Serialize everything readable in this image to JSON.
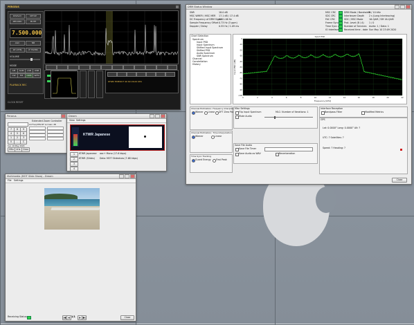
{
  "desktop": {
    "colors": {
      "background": "#8a939d",
      "apple_logo": "#d7d9dc"
    }
  },
  "perseus": {
    "title": "PERSEUS",
    "frequency": "7.500.000",
    "status_line": "KTWR  TIMEOUT  40  60  26.00 KHz",
    "playback_label": "PLAYBACK REC",
    "bottom_line": "CLOCK RESET",
    "labels": [
      "DISPLAY",
      "SETUP",
      "RECORD",
      "MUTE",
      "AGC",
      "NB",
      "RF ATTN",
      "IF FILTER",
      "VOLUME",
      "MODE"
    ],
    "mode_buttons": [
      "AM",
      "SAM",
      "LSB",
      "USB",
      "CW",
      "FM",
      "DRM",
      "WFM"
    ],
    "colors": {
      "panel": "#1c1c1c",
      "freq": "#f1c34a",
      "spectrum": "#d0d0d0",
      "accent": "#3ad65a"
    }
  },
  "drm": {
    "title": "DRM Status Window",
    "stats_left": [
      {
        "k": "SNR",
        "v": "18.0 dB"
      },
      {
        "k": "MSC WMER / MSC MER",
        "v": "17.1 dB / 17.4 dB"
      },
      {
        "k": "DC Frequency of DRM Signal",
        "v": "6011.06 Hz"
      },
      {
        "k": "Sample Frequency Offset",
        "v": "0.73 Hz (3 ppm)"
      },
      {
        "k": "Doppler / Delay",
        "v": "0.55 Hz / 1.09 ms"
      }
    ],
    "stats_right": [
      {
        "k": "DRM Mode / Bandwidth",
        "v": "B / 10 kHz"
      },
      {
        "k": "Interleaver Depth",
        "v": "2 s (Long Interleaving)"
      },
      {
        "k": "SDC / MSC Mode",
        "v": "16-QAM / SM 16-QAM"
      },
      {
        "k": "Prot. Level (B / A)",
        "v": "1 / 0"
      },
      {
        "k": "Number of Services",
        "v": "Audio: 1 / Data: 1"
      },
      {
        "k": "Received time - date",
        "v": "Sun May 10 23:09 2020"
      }
    ],
    "status_labels": [
      "MSC CRC",
      "SDC CRC",
      "FAC CRC",
      "Frame Sync",
      "Time Sync Acq",
      "IO Interface"
    ],
    "tree": [
      "Chart Selection",
      "Spectrum",
      "Input PSD",
      "Input Spectrum",
      "Shifted Input Spectrum",
      "Shifted PSD",
      "Audio Spectrum",
      "SNR Spectrum",
      "Channel",
      "Constellation",
      "History"
    ],
    "chart": {
      "title": "Input PSD",
      "xlabel": "Frequency [kHz]",
      "ylabel": "Input PSD [dB]",
      "xticks": [
        "0",
        "2",
        "4",
        "6",
        "8",
        "10",
        "12",
        "14",
        "16",
        "18",
        "20",
        "22"
      ],
      "yticks": [
        "0",
        "-10",
        "-20",
        "-30",
        "-40",
        "-50",
        "-60",
        "-70",
        "-80",
        "-90",
        "-100"
      ],
      "line_color": "#2fe82f",
      "background": "#000000"
    },
    "bottom": {
      "chan_est_freq_title": "Channel Estimation: Frequency Interpolation",
      "freq_opts": [
        "Wiener",
        "Linear",
        "DFT Zero Pad"
      ],
      "chan_est_time_title": "Channel Estimation: Time Interpolation",
      "time_opts": [
        "Wiener",
        "Linear"
      ],
      "time_sync_title": "Time Sync Tracking",
      "sync_opts": [
        "Guard Energy",
        "First Peak"
      ],
      "misc_title": "Misc Settings",
      "misc_opts": [
        "Flip Input Spectrum",
        "Mute Audio"
      ],
      "mlc_label": "MLC: Number of Iterations: 1",
      "file_title": "Save File Audio",
      "file_opts": [
        "Save File Timer",
        "Save Audio as WAV",
        "Reverberation"
      ],
      "iface_title": "Interface Reception",
      "iface_opts": [
        "Bandpass Filter",
        "Modified Metrics"
      ],
      "gps_title": "GPS",
      "gps_lines": [
        "Lat: 0.0000°  Long: 0.0000°  Alt: ?",
        "UTC: ?  Satellites: ?",
        "Speed: ?  Heading: ?"
      ],
      "close": "Close"
    }
  },
  "clock": {
    "title": "Perseus",
    "subtitle": "Extended Zoom Controller",
    "grid_header": "LO Freq  MHz  RF Lvl  Gain dB",
    "keypad": [
      "7",
      "8",
      "9",
      "4",
      "5",
      "6",
      "1",
      "2",
      "3",
      "0",
      ".",
      "C"
    ],
    "date": "Sun 10 May 2020",
    "buttons": [
      "MHz",
      "kHz",
      "Clear"
    ]
  },
  "dream": {
    "title": "Dream",
    "menu": [
      "View",
      "Settings"
    ],
    "station": "KTWR  Japanese",
    "services": [
      {
        "num": "1",
        "name": "KTWR  Japanese",
        "info": "aac+ Mono (17.6 kbps)"
      },
      {
        "num": "2",
        "name": "KTWR  (Slides)",
        "info": "Data: MOT Slideshow (7.68 kbps)"
      },
      {
        "num": "3",
        "name": "",
        "info": ""
      },
      {
        "num": "4",
        "name": "",
        "info": ""
      }
    ],
    "colors": {
      "display": "#0b0f1f",
      "station_text": "#e8f2ff",
      "frame": "#b81d1d"
    }
  },
  "slideshow": {
    "title": "Multimedia (MOT Slide Show) - Dream",
    "menu": [
      "File",
      "Settings"
    ],
    "status_label": "Receiving Status:",
    "page": "1/1",
    "close": "Close"
  }
}
